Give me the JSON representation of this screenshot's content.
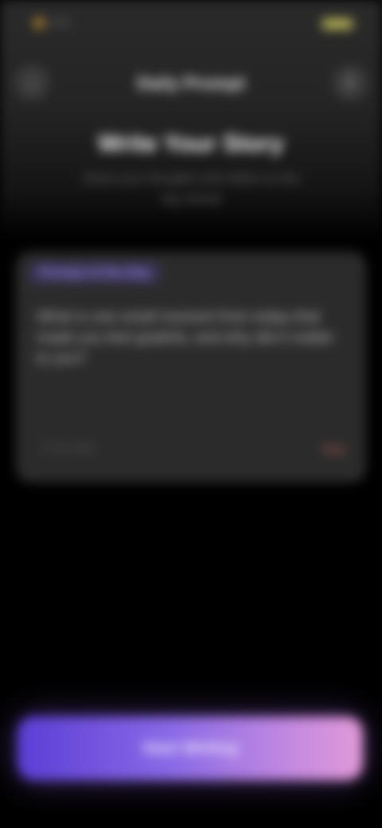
{
  "status_bar": {
    "time": "9:41",
    "indicators": "▮▮▮ ◠",
    "battery_color": "#c6c25a"
  },
  "nav": {
    "back_icon": "chevron-left-icon",
    "back_glyph": "‹",
    "title": "Daily Prompt",
    "action_icon": "share-icon",
    "action_glyph": "⇪"
  },
  "header": {
    "heading": "Write Your Story",
    "subtitle": "Share your thoughts and reflect on the day ahead"
  },
  "card": {
    "tag": "Prompt of the Day",
    "body": "What is one small moment from today that made you feel grateful, and why did it matter to you?",
    "footer_left": "2 min read",
    "footer_right": "Skip"
  },
  "cta": {
    "label": "Start Writing"
  },
  "colors": {
    "background": "#000000",
    "card": "#2b2b2b",
    "accent_purple": "#9d8ef5",
    "cta_start": "#5b3ed6",
    "cta_end": "#e29ad8",
    "skip": "#a05a52"
  }
}
